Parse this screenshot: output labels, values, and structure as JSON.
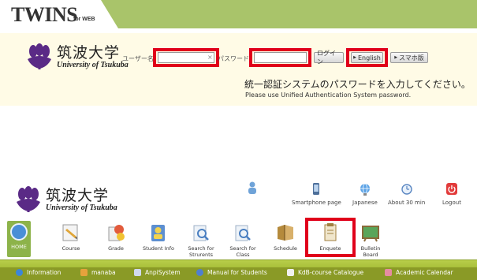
{
  "header": {
    "title": "TWINS",
    "subtitle": "for WEB"
  },
  "university": {
    "name_jp": "筑波大学",
    "name_en": "University of Tsukuba"
  },
  "login": {
    "username_label": "ユーザー名",
    "username_value": "",
    "clear_glyph": "×",
    "password_label": "パスワード",
    "password_value": "",
    "login_button": "ログイン",
    "english_button": "English",
    "smartphone_button": "スマホ版",
    "notice_jp": "統一認証システムのパスワードを入力してください。",
    "notice_en": "Please use Unified Authentication System password."
  },
  "utility": [
    {
      "label": "",
      "icon": "user-icon"
    },
    {
      "label": "Smartphone page",
      "icon": "smartphone-icon"
    },
    {
      "label": "Japanese",
      "icon": "globe-icon"
    },
    {
      "label": "About 30 min",
      "icon": "clock-icon"
    },
    {
      "label": "Logout",
      "icon": "power-icon"
    }
  ],
  "nav": [
    {
      "label": "HOME",
      "icon": "home-icon"
    },
    {
      "label": "Course",
      "icon": "course-icon"
    },
    {
      "label": "Grade",
      "icon": "grade-icon"
    },
    {
      "label": "Student Info",
      "icon": "student-info-icon"
    },
    {
      "label": "Search for\nStrurents",
      "icon": "search-students-icon"
    },
    {
      "label": "Search for\nClass",
      "icon": "search-class-icon"
    },
    {
      "label": "Schedule",
      "icon": "schedule-icon"
    },
    {
      "label": "Enquete",
      "icon": "enquete-icon"
    },
    {
      "label": "Bulletin\nBoard",
      "icon": "bulletin-board-icon"
    }
  ],
  "links": [
    {
      "label": "Information",
      "icon": "info-icon"
    },
    {
      "label": "manaba",
      "icon": "manaba-icon"
    },
    {
      "label": "AnpiSystem",
      "icon": "anpi-icon"
    },
    {
      "label": "Manual for Students",
      "icon": "manual-icon"
    },
    {
      "label": "KdB-course Catalogue",
      "icon": "catalogue-icon"
    },
    {
      "label": "Academic Calendar",
      "icon": "calendar-icon"
    }
  ],
  "colors": {
    "header_green": "#a9c46a",
    "highlight_red": "#e0001a",
    "panel_cream": "#fffbe6",
    "nav_green": "#8db34a"
  }
}
